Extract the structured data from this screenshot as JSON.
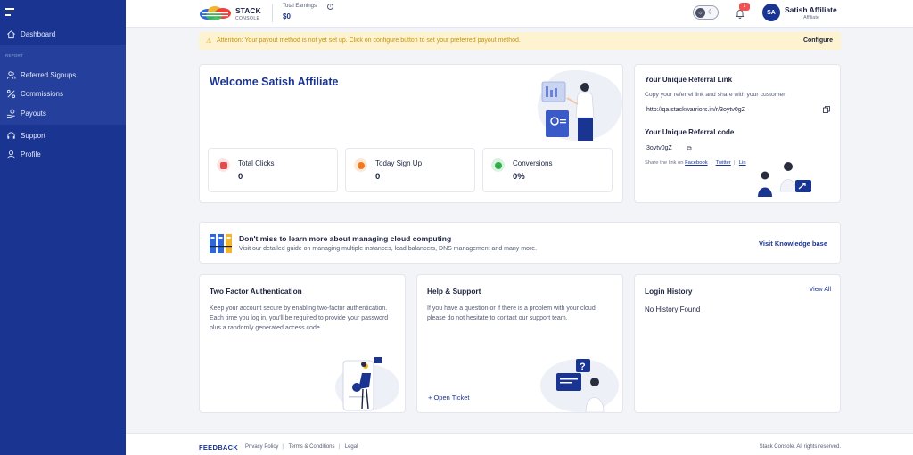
{
  "sidebar": {
    "section_label": "REPORT",
    "items": [
      {
        "label": "Dashboard",
        "icon": "home-icon"
      },
      {
        "label": "Referred Signups",
        "icon": "users-icon"
      },
      {
        "label": "Commissions",
        "icon": "percent-icon"
      },
      {
        "label": "Payouts",
        "icon": "hand-coins-icon"
      },
      {
        "label": "Support",
        "icon": "headset-icon"
      },
      {
        "label": "Profile",
        "icon": "user-icon"
      }
    ]
  },
  "header": {
    "brand_name": "STACK",
    "brand_sub": "CONSOLE",
    "earnings_label": "Total Earnings",
    "earnings_value": "$0",
    "notification_count": "1",
    "user_initials": "SA",
    "user_name": "Satish Affiliate",
    "user_role": "Affiliate"
  },
  "alert": {
    "message": "Attention: Your payout method is not yet set up. Click on configure button to set your preferred payout method.",
    "action": "Configure"
  },
  "welcome": {
    "title": "Welcome Satish Affiliate",
    "stats": [
      {
        "label": "Total Clicks",
        "value": "0",
        "color": "#e24b4b"
      },
      {
        "label": "Today Sign Up",
        "value": "0",
        "color": "#f07a22"
      },
      {
        "label": "Conversions",
        "value": "0%",
        "color": "#2fae4e"
      }
    ]
  },
  "referral": {
    "link_title": "Your Unique Referral Link",
    "link_desc": "Copy your referrel link and share with your customer",
    "link_url": "http://qa.stackwarriors.in/r/3oytv0gZ",
    "code_title": "Your Unique Referral code",
    "code_value": "3oytv0gZ",
    "share_prefix": "Share the link on",
    "share_links": [
      "Facebook",
      "Twitter",
      "Lin"
    ]
  },
  "knowledge": {
    "title": "Don't miss to learn more about managing cloud computing",
    "desc": "Visit our detailed guide on managing multiple instances, load balancers, DNS management and many more.",
    "action": "Visit Knowledge base"
  },
  "two_factor": {
    "title": "Two Factor Authentication",
    "body": "Keep your account secure by enabling two-factor authentication. Each time you log in, you'll be required to provide your password plus a randomly generated access code"
  },
  "help": {
    "title": "Help & Support",
    "body": "If you have a question or if there is a problem with your cloud, please do not hesitate to contact our support team.",
    "action": "+ Open Ticket"
  },
  "login_history": {
    "title": "Login History",
    "action": "View All",
    "empty": "No History Found"
  },
  "footer": {
    "feedback": "FEEDBACK",
    "links": [
      "Privacy Policy",
      "Terms & Conditions",
      "Legal"
    ],
    "copyright": "Stack Console. All rights reserved."
  },
  "colors": {
    "brand": "#1a3492",
    "alert_bg": "#fdf3d0",
    "alert_text": "#c9930a"
  }
}
